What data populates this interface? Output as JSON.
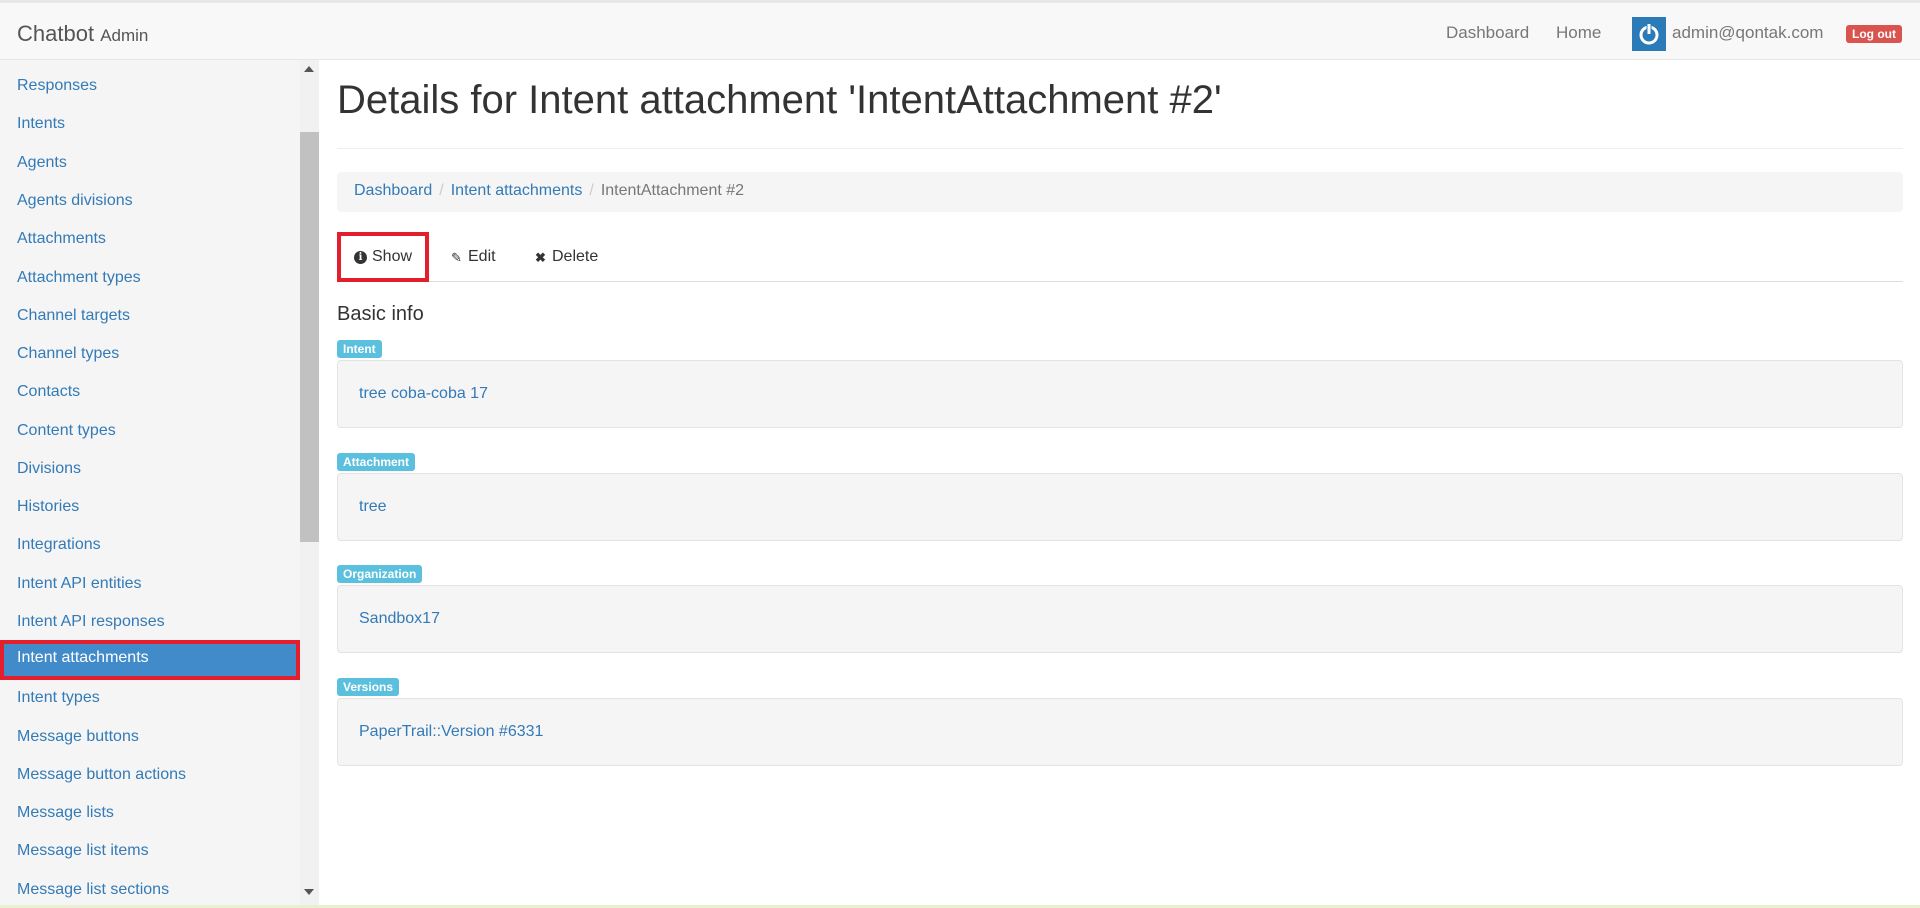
{
  "navbar": {
    "brand": "Chatbot",
    "brand_sub": "Admin",
    "links": [
      "Dashboard",
      "Home"
    ],
    "user_email": "admin@qontak.com",
    "logout_label": "Log out"
  },
  "sidebar": {
    "items": [
      "Responses",
      "Intents",
      "Agents",
      "Agents divisions",
      "Attachments",
      "Attachment types",
      "Channel targets",
      "Channel types",
      "Contacts",
      "Content types",
      "Divisions",
      "Histories",
      "Integrations",
      "Intent API entities",
      "Intent API responses",
      "Intent attachments",
      "Intent types",
      "Message buttons",
      "Message button actions",
      "Message lists",
      "Message list items",
      "Message list sections"
    ],
    "active_item": "Intent attachments"
  },
  "main": {
    "title": "Details for Intent attachment 'IntentAttachment #2'",
    "breadcrumb": {
      "links": [
        "Dashboard",
        "Intent attachments"
      ],
      "current": "IntentAttachment #2"
    },
    "tabs": {
      "show": "Show",
      "edit": "Edit",
      "delete": "Delete"
    },
    "section_heading": "Basic info",
    "fields": [
      {
        "label": "Intent",
        "value": "tree coba-coba 17"
      },
      {
        "label": "Attachment",
        "value": "tree"
      },
      {
        "label": "Organization",
        "value": "Sandbox17"
      },
      {
        "label": "Versions",
        "value": "PaperTrail::Version #6331"
      }
    ]
  },
  "colors": {
    "link": "#337ab7",
    "active_bg": "#428bca",
    "highlight_border": "#e31e2d",
    "label_bg": "#5bc0de",
    "logout_bg": "#d9534f"
  }
}
